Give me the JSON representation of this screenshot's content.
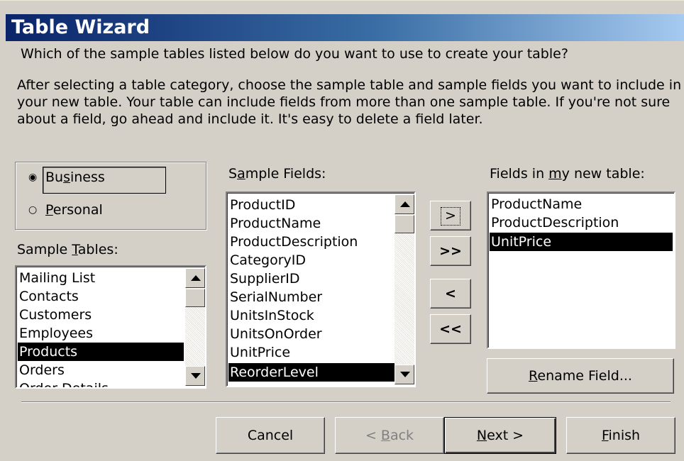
{
  "window": {
    "title": "Table Wizard"
  },
  "instructions": {
    "question": "Which of the sample tables listed below do you want to use to create your table?",
    "lines": [
      "After selecting a table category, choose the sample table and sample fields you want to include in",
      "your new table. Your table can include fields from more than one sample table. If you're not sure",
      "about a field, go ahead and include it. It's easy to delete a field later."
    ]
  },
  "category": {
    "selected": "Business",
    "options": [
      {
        "pre": "Bu",
        "key": "s",
        "post": "iness",
        "checked": true
      },
      {
        "pre": "",
        "key": "P",
        "post": "ersonal",
        "checked": false
      }
    ]
  },
  "sample_tables": {
    "label_pre": "Sample ",
    "label_key": "T",
    "label_post": "ables:",
    "items": [
      "Mailing List",
      "Contacts",
      "Customers",
      "Employees",
      "Products",
      "Orders",
      "Order Details"
    ],
    "selected": "Products"
  },
  "sample_fields": {
    "label_pre": "S",
    "label_key": "a",
    "label_post": "mple Fields:",
    "items": [
      "ProductID",
      "ProductName",
      "ProductDescription",
      "CategoryID",
      "SupplierID",
      "SerialNumber",
      "UnitsInStock",
      "UnitsOnOrder",
      "UnitPrice",
      "ReorderLevel"
    ],
    "selected": "ReorderLevel"
  },
  "move_buttons": {
    "add_one": ">",
    "add_all": ">>",
    "remove_one": "<",
    "remove_all": "<<"
  },
  "new_table_fields": {
    "label_pre": "Fields in ",
    "label_key": "m",
    "label_post": "y new table:",
    "items": [
      "ProductName",
      "ProductDescription",
      "UnitPrice"
    ],
    "selected": "UnitPrice"
  },
  "rename_button": {
    "key": "R",
    "post": "ename Field..."
  },
  "footer": {
    "cancel": "Cancel",
    "back_pre": "< ",
    "back_key": "B",
    "back_post": "ack",
    "next_key": "N",
    "next_post": "ext >",
    "finish_key": "F",
    "finish_post": "inish"
  },
  "colors": {
    "title_start": "#0a246a",
    "title_end": "#a6caf0",
    "dialog_bg": "#d4d0c8",
    "selection": "#000000"
  }
}
